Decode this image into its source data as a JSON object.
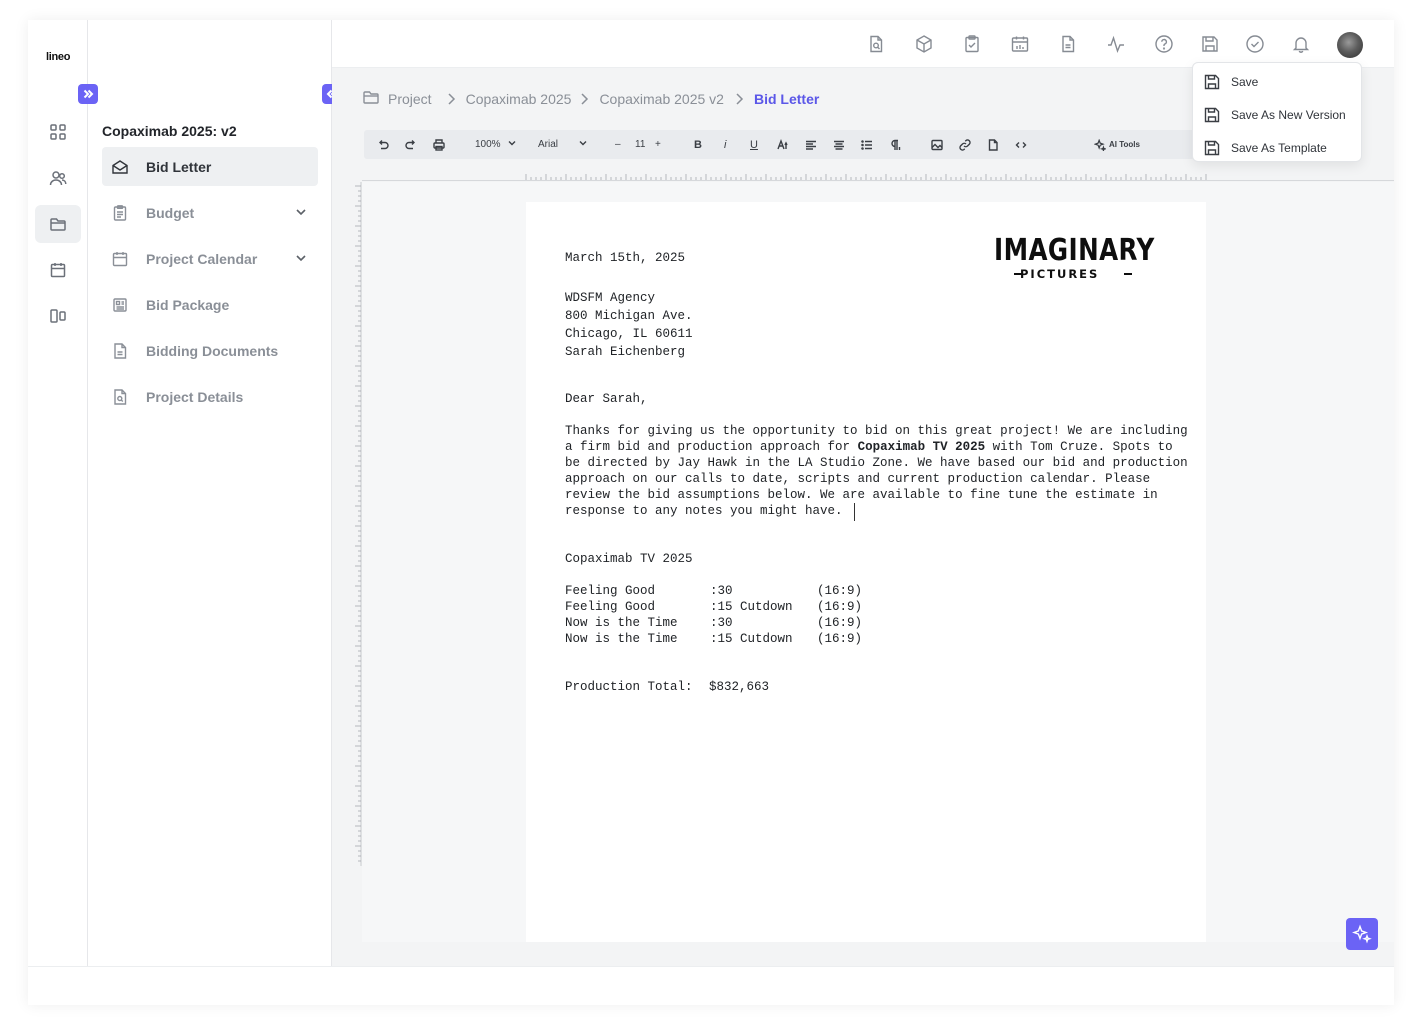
{
  "app": {
    "logo": "lineo"
  },
  "rail": {
    "items": [
      {
        "icon": "grid-icon"
      },
      {
        "icon": "users-icon"
      },
      {
        "icon": "folder-icon",
        "active": true
      },
      {
        "icon": "calendar-icon"
      },
      {
        "icon": "layout-icon"
      }
    ]
  },
  "sidebar": {
    "project_title": "Copaximab 2025: v2",
    "items": [
      {
        "label": "Bid Letter",
        "icon": "envelope-icon",
        "active": true
      },
      {
        "label": "Budget",
        "icon": "clipboard-icon",
        "has_children": true
      },
      {
        "label": "Project Calendar",
        "icon": "calendar-icon",
        "has_children": true
      },
      {
        "label": "Bid Package",
        "icon": "newspaper-icon"
      },
      {
        "label": "Bidding Documents",
        "icon": "document-icon"
      },
      {
        "label": "Project Details",
        "icon": "file-search-icon"
      }
    ]
  },
  "topbar": {
    "icons": [
      "file-search-icon",
      "cube-icon",
      "clipboard-check-icon",
      "calendar-chart-icon",
      "document-icon",
      "activity-icon",
      "help-icon",
      "save-icon",
      "check-circle-icon",
      "bell-icon"
    ],
    "avatar": "avatar"
  },
  "breadcrumb": {
    "items": [
      "Project",
      "Copaximab 2025",
      "Copaximab 2025 v2"
    ],
    "current": "Bid Letter"
  },
  "toolbar": {
    "zoom": "100%",
    "font": "Arial",
    "font_size": "11",
    "bold": "B",
    "italic": "i",
    "underline": "U",
    "ai_tools": "AI Tools"
  },
  "save_menu": {
    "items": [
      "Save",
      "Save As New Version",
      "Save As Template"
    ]
  },
  "document": {
    "logo": {
      "big": "IMAGINARY",
      "small": "PICTURES"
    },
    "date": "March 15th, 2025",
    "address": [
      "WDSFM Agency",
      "800 Michigan Ave.",
      "Chicago, IL 60611",
      "Sarah Eichenberg"
    ],
    "greeting": "Dear Sarah,",
    "body": {
      "l1": "Thanks for giving us the opportunity to bid on this great project! We are including",
      "l2_a": "a firm bid and production approach for ",
      "l2_b": "Copaximab TV 2025",
      "l2_c": " with Tom Cruze. Spots to",
      "l3": "be directed by Jay Hawk in the LA Studio Zone. We have based our bid and production",
      "l4": "approach on our calls to date, scripts and current production calendar. Please",
      "l5": "review the bid assumptions below. We are available to fine tune the estimate in",
      "l6": "response to any notes you might have."
    },
    "section_title": "Copaximab TV 2025",
    "spots": [
      {
        "name": "Feeling Good",
        "length": ":30",
        "ratio": "(16:9)"
      },
      {
        "name": "Feeling Good",
        "length": ":15 Cutdown",
        "ratio": "(16:9)"
      },
      {
        "name": "Now is the Time",
        "length": ":30",
        "ratio": "(16:9)"
      },
      {
        "name": "Now is the Time",
        "length": ":15 Cutdown",
        "ratio": "(16:9)"
      }
    ],
    "total_label": "Production Total:",
    "total_value": "$832,663"
  },
  "colors": {
    "accent": "#6b63f5",
    "breadcrumb_current": "#5b57e8"
  }
}
